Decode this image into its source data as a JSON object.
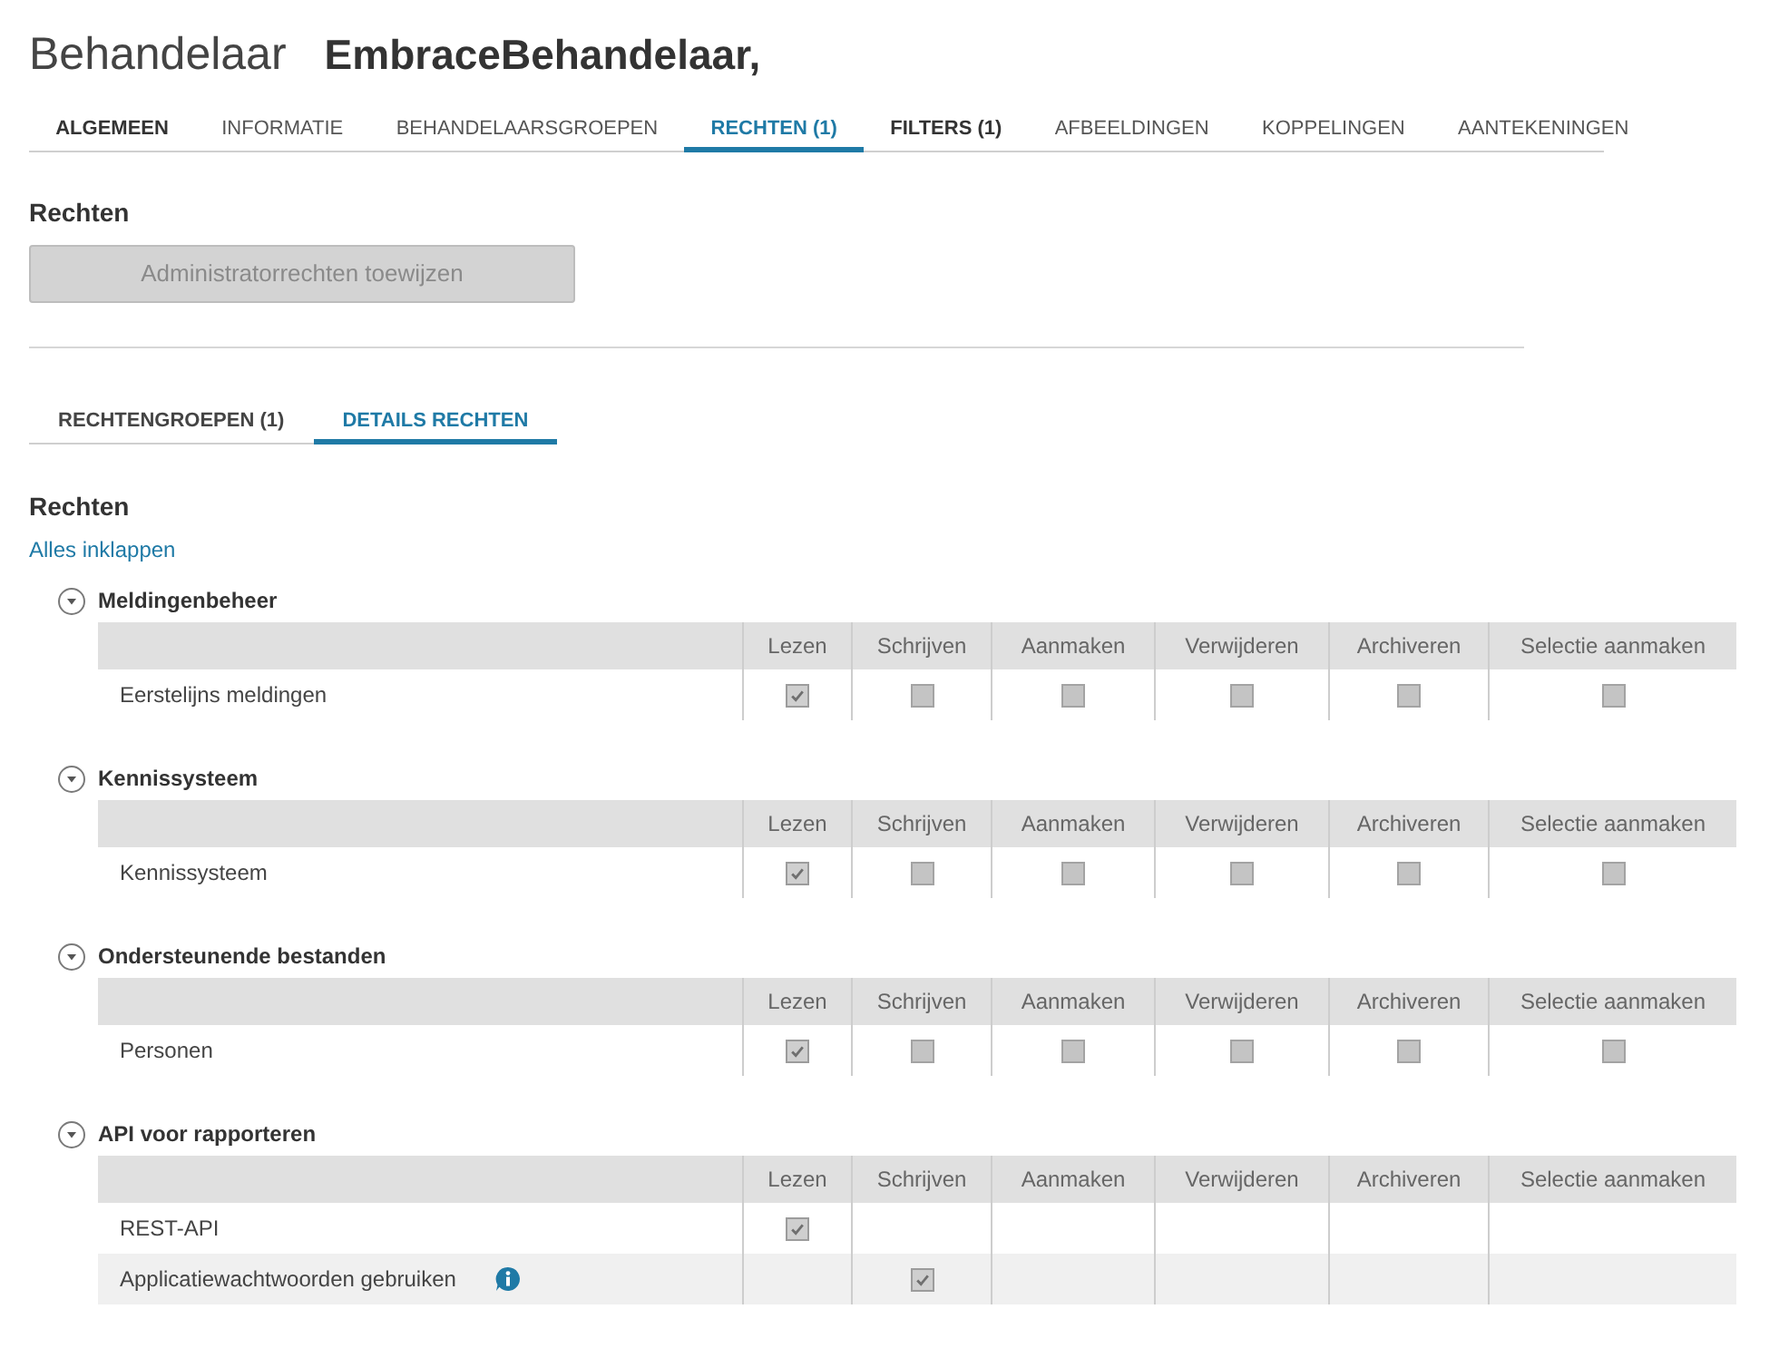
{
  "page": {
    "title_label": "Behandelaar",
    "title_name": "EmbraceBehandelaar,"
  },
  "tabs": [
    {
      "label": "ALGEMEEN",
      "selected": false,
      "bold": true
    },
    {
      "label": "INFORMATIE",
      "selected": false,
      "bold": false
    },
    {
      "label": "BEHANDELAARSGROEPEN",
      "selected": false,
      "bold": false
    },
    {
      "label": "RECHTEN (1)",
      "selected": true,
      "bold": true
    },
    {
      "label": "FILTERS (1)",
      "selected": false,
      "bold": true
    },
    {
      "label": "AFBEELDINGEN",
      "selected": false,
      "bold": false
    },
    {
      "label": "KOPPELINGEN",
      "selected": false,
      "bold": false
    },
    {
      "label": "AANTEKENINGEN",
      "selected": false,
      "bold": false
    }
  ],
  "rights_panel": {
    "heading": "Rechten",
    "admin_button": {
      "label": "Administratorrechten toewijzen",
      "disabled": true
    }
  },
  "subtabs": [
    {
      "label": "RECHTENGROEPEN (1)",
      "selected": false
    },
    {
      "label": "DETAILS RECHTEN",
      "selected": true
    }
  ],
  "details": {
    "heading": "Rechten",
    "collapse_link": "Alles inklappen",
    "sections": [
      {
        "title": "Meldingenbeheer",
        "expanded": true,
        "columns": [
          "Lezen",
          "Schrijven",
          "Aanmaken",
          "Verwijderen",
          "Archiveren",
          "Selectie aanmaken"
        ],
        "rows": [
          {
            "label": "Eerstelijns meldingen",
            "info": false,
            "permissions": [
              {
                "kind": "checkbox",
                "checked": true
              },
              {
                "kind": "checkbox",
                "checked": false
              },
              {
                "kind": "checkbox",
                "checked": false
              },
              {
                "kind": "checkbox",
                "checked": false
              },
              {
                "kind": "checkbox",
                "checked": false
              },
              {
                "kind": "checkbox",
                "checked": false
              }
            ]
          }
        ]
      },
      {
        "title": "Kennissysteem",
        "expanded": true,
        "columns": [
          "Lezen",
          "Schrijven",
          "Aanmaken",
          "Verwijderen",
          "Archiveren",
          "Selectie aanmaken"
        ],
        "rows": [
          {
            "label": "Kennissysteem",
            "info": false,
            "permissions": [
              {
                "kind": "checkbox",
                "checked": true
              },
              {
                "kind": "checkbox",
                "checked": false
              },
              {
                "kind": "checkbox",
                "checked": false
              },
              {
                "kind": "checkbox",
                "checked": false
              },
              {
                "kind": "checkbox",
                "checked": false
              },
              {
                "kind": "checkbox",
                "checked": false
              }
            ]
          }
        ]
      },
      {
        "title": "Ondersteunende bestanden",
        "expanded": true,
        "columns": [
          "Lezen",
          "Schrijven",
          "Aanmaken",
          "Verwijderen",
          "Archiveren",
          "Selectie aanmaken"
        ],
        "rows": [
          {
            "label": "Personen",
            "info": false,
            "permissions": [
              {
                "kind": "checkbox",
                "checked": true
              },
              {
                "kind": "checkbox",
                "checked": false
              },
              {
                "kind": "checkbox",
                "checked": false
              },
              {
                "kind": "checkbox",
                "checked": false
              },
              {
                "kind": "checkbox",
                "checked": false
              },
              {
                "kind": "checkbox",
                "checked": false
              }
            ]
          }
        ]
      },
      {
        "title": "API voor rapporteren",
        "expanded": true,
        "columns": [
          "Lezen",
          "Schrijven",
          "Aanmaken",
          "Verwijderen",
          "Archiveren",
          "Selectie aanmaken"
        ],
        "rows": [
          {
            "label": "REST-API",
            "info": false,
            "permissions": [
              {
                "kind": "checkbox",
                "checked": true
              },
              {
                "kind": "blank"
              },
              {
                "kind": "blank"
              },
              {
                "kind": "blank"
              },
              {
                "kind": "blank"
              },
              {
                "kind": "blank"
              }
            ]
          },
          {
            "label": "Applicatiewachtwoorden gebruiken",
            "info": true,
            "permissions": [
              {
                "kind": "blank"
              },
              {
                "kind": "checkbox",
                "checked": true
              },
              {
                "kind": "blank"
              },
              {
                "kind": "blank"
              },
              {
                "kind": "blank"
              },
              {
                "kind": "blank"
              }
            ]
          }
        ]
      }
    ]
  }
}
